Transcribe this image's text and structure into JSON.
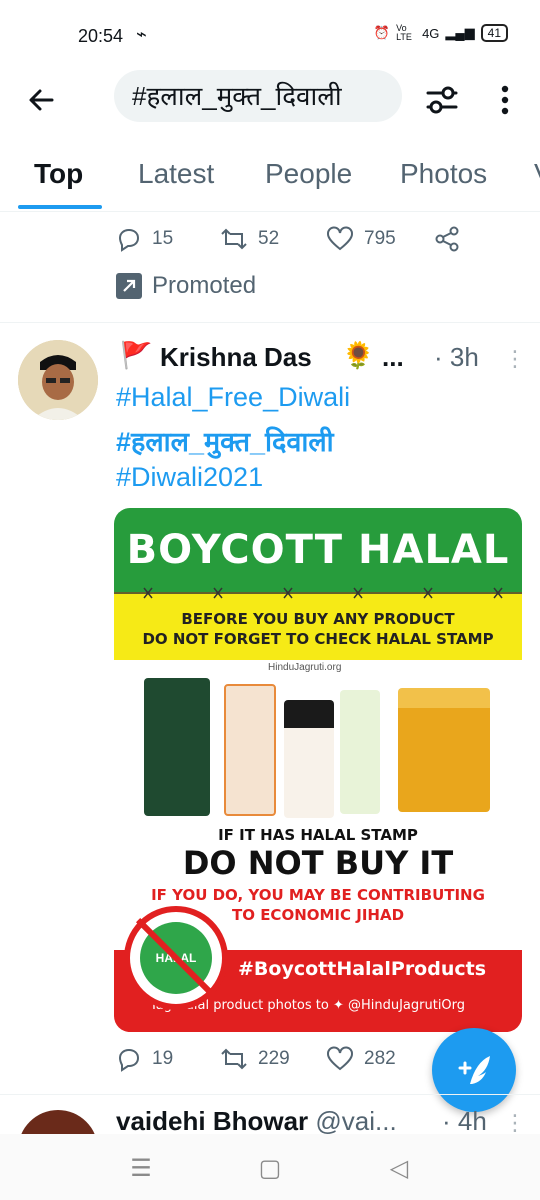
{
  "status_bar": {
    "time": "20:54",
    "missed_call_glyph": "⌁",
    "network_label": "4G",
    "volte_label": "Vo LTE",
    "battery": "41"
  },
  "search": {
    "query": "#हलाल_मुक्त_दिवाली"
  },
  "tabs": [
    {
      "label": "Top",
      "active": true
    },
    {
      "label": "Latest",
      "active": false
    },
    {
      "label": "People",
      "active": false
    },
    {
      "label": "Photos",
      "active": false
    },
    {
      "label": "V",
      "active": false
    }
  ],
  "prev_tweet": {
    "replies": "15",
    "retweets": "52",
    "likes": "795",
    "promoted_label": "Promoted"
  },
  "tweet": {
    "author_name": "Krishna Das",
    "author_flag_icon": "🚩",
    "author_emoji": "🌻",
    "name_ellipsis": "...",
    "time": "· 3h",
    "hashtags": [
      "#Halal_Free_Diwali",
      "#हलाल_मुक्त_दिवाली",
      "#Diwali2021"
    ],
    "image": {
      "headline": "BOYCOTT HALAL",
      "line1": "BEFORE YOU BUY ANY PRODUCT",
      "line2": "DO NOT FORGET TO CHECK HALAL STAMP",
      "source": "HinduJagruti.org",
      "stamp_text": "IF IT HAS HALAL STAMP",
      "big_text": "DO NOT BUY IT",
      "red_text1": "IF YOU DO, YOU MAY BE CONTRIBUTING",
      "red_text2": "TO ECONOMIC JIHAD",
      "halal_logo": "HALAL",
      "hashtag": "#BoycottHalalProducts",
      "tag_line": "Tag Halal product photos to",
      "tag_handle": "@HinduJagrutiOrg"
    },
    "replies": "19",
    "retweets": "229",
    "likes": "282"
  },
  "next_tweet": {
    "author_name": "vaidehi Bhowar",
    "handle": "@vai...",
    "time": "· 4h"
  },
  "colors": {
    "accent": "#1d9bf0",
    "text_secondary": "#536471",
    "banner_green": "#279c3c",
    "banner_yellow": "#f6ea16",
    "banner_red": "#e12020"
  }
}
